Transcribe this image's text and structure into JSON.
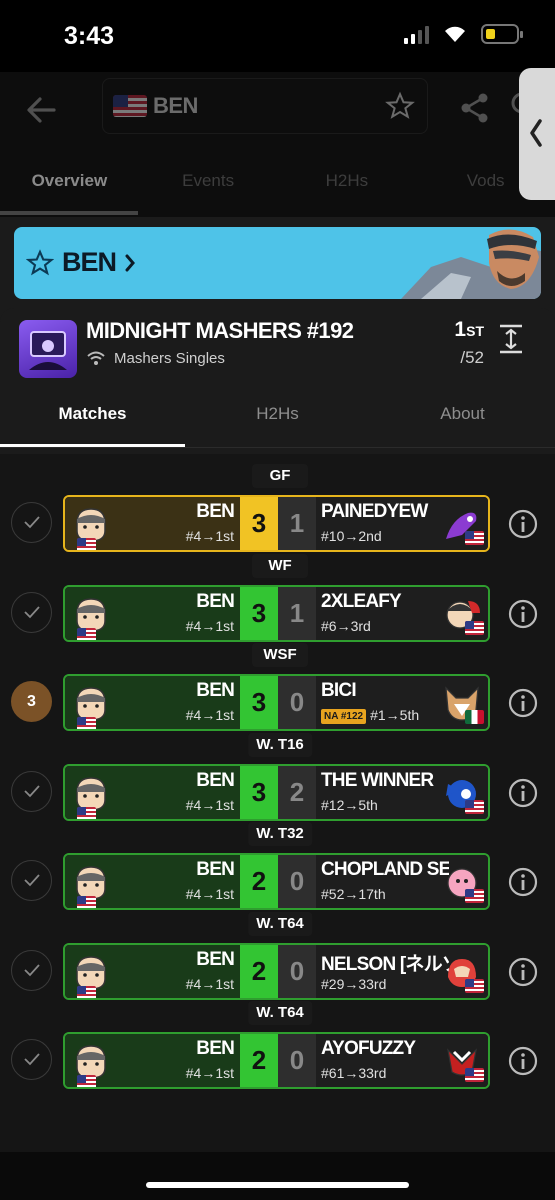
{
  "status_bar": {
    "time": "3:43"
  },
  "search": {
    "player_name": "BEN"
  },
  "top_tabs": [
    {
      "label": "Overview"
    },
    {
      "label": "Events"
    },
    {
      "label": "H2Hs"
    },
    {
      "label": "Vods"
    }
  ],
  "banner": {
    "player_name": "BEN"
  },
  "event": {
    "title": "MIDNIGHT MASHERS #192",
    "subtitle": "Mashers Singles",
    "placing": "1",
    "placing_suffix": "ST",
    "entrants": "/52"
  },
  "tabs": [
    {
      "label": "Matches"
    },
    {
      "label": "H2Hs"
    },
    {
      "label": "About"
    }
  ],
  "matches": [
    {
      "round": "GF",
      "left_name": "BEN",
      "left_seed": "#4→1st",
      "score_w": "3",
      "score_l": "1",
      "right_name": "PAINEDYEW",
      "right_seed": "#10→2nd",
      "badge": ""
    },
    {
      "round": "WF",
      "left_name": "BEN",
      "left_seed": "#4→1st",
      "score_w": "3",
      "score_l": "1",
      "right_name": "2XLEAFY",
      "right_seed": "#6→3rd",
      "badge": ""
    },
    {
      "round": "WSF",
      "left_name": "BEN",
      "left_seed": "#4→1st",
      "score_w": "3",
      "score_l": "0",
      "right_name": "BICI",
      "right_seed": "#1→5th",
      "badge": "3",
      "right_tag": "NA #122"
    },
    {
      "round": "W. T16",
      "left_name": "BEN",
      "left_seed": "#4→1st",
      "score_w": "3",
      "score_l": "2",
      "right_name": "THE WINNER",
      "right_seed": "#12→5th",
      "badge": ""
    },
    {
      "round": "W. T32",
      "left_name": "BEN",
      "left_seed": "#4→1st",
      "score_w": "2",
      "score_l": "0",
      "right_name": "CHOPLAND SED...",
      "right_seed": "#52→17th",
      "badge": ""
    },
    {
      "round": "W. T64",
      "left_name": "BEN",
      "left_seed": "#4→1st",
      "score_w": "2",
      "score_l": "0",
      "right_name": "NELSON [ネルソ...",
      "right_seed": "#29→33rd",
      "badge": ""
    },
    {
      "round": "W. T64",
      "left_name": "BEN",
      "left_seed": "#4→1st",
      "score_w": "2",
      "score_l": "0",
      "right_name": "AYOFUZZY",
      "right_seed": "#61→33rd",
      "badge": ""
    }
  ],
  "colors": {
    "win_green": "#33c533",
    "gold": "#f1c324",
    "banner_blue": "#4ec3e8",
    "event_purple": "#6a3fd0"
  }
}
